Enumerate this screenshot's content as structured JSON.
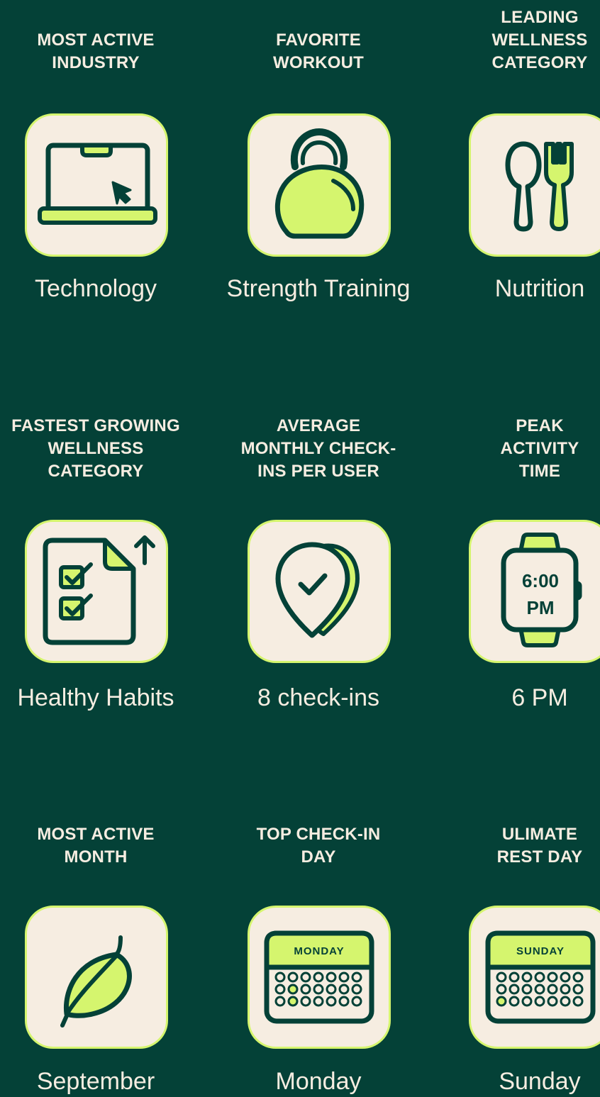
{
  "colors": {
    "background": "#044137",
    "tile": "#F6EDE1",
    "accent": "#D5F56E",
    "ink": "#044137",
    "text": "#F6EDE1"
  },
  "stats": [
    {
      "label": "MOST ACTIVE\nINDUSTRY",
      "value": "Technology",
      "icon": "laptop-icon"
    },
    {
      "label": "FAVORITE\nWORKOUT",
      "value": "Strength Training",
      "icon": "kettlebell-icon"
    },
    {
      "label": "LEADING\nWELLNESS\nCATEGORY",
      "value": "Nutrition",
      "icon": "spoon-fork-icon"
    },
    {
      "label": "FASTEST GROWING\nWELLNESS\nCATEGORY",
      "value": "Healthy Habits",
      "icon": "checklist-icon"
    },
    {
      "label": "AVERAGE\nMONTHLY CHECK-\nINS PER USER",
      "value": "8 check-ins",
      "icon": "location-check-icon"
    },
    {
      "label": "PEAK\nACTIVITY\nTIME",
      "value": "6 PM",
      "icon": "smartwatch-icon",
      "icon_text": "6:00\nPM"
    },
    {
      "label": "MOST ACTIVE\nMONTH",
      "value": "September",
      "icon": "leaf-icon"
    },
    {
      "label": "TOP CHECK-IN\nDAY",
      "value": "Monday",
      "icon": "calendar-icon",
      "icon_text": "MONDAY"
    },
    {
      "label": "ULIMATE\nREST DAY",
      "value": "Sunday",
      "icon": "calendar-icon",
      "icon_text": "SUNDAY"
    }
  ]
}
